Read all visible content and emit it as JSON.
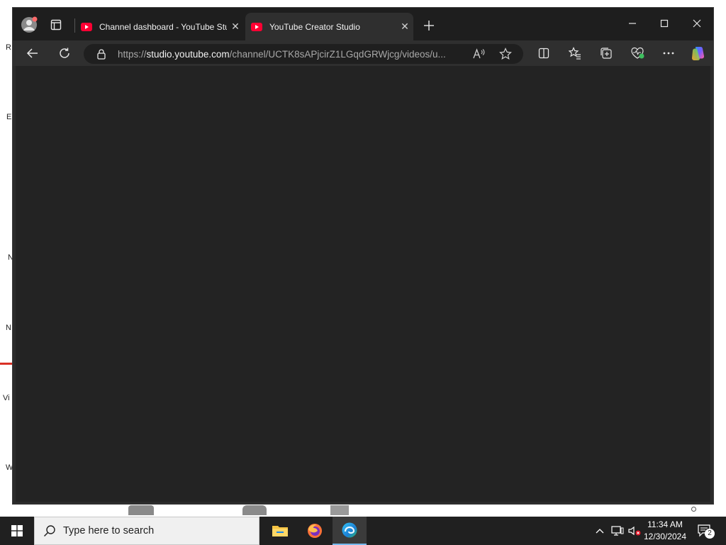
{
  "browser": {
    "tabs": [
      {
        "title": "Channel dashboard - YouTube Studio",
        "active": false
      },
      {
        "title": "YouTube Creator Studio",
        "active": true
      }
    ],
    "new_tab_icon": "plus-icon",
    "address": {
      "scheme": "https://",
      "host": "studio.youtube.com",
      "path": "/channel/UCTK8sAPjcirZ1LGqdGRWjcg/videos/u..."
    },
    "window_controls": [
      "minimize-icon",
      "maximize-icon",
      "close-icon"
    ],
    "toolbar_icons": [
      "read-aloud-icon",
      "favorite-star-icon",
      "split-screen-icon",
      "favorites-icon",
      "collections-icon",
      "browser-essentials-icon",
      "more-icon",
      "copilot-icon"
    ]
  },
  "desktop": {
    "edge_marks": [
      "R",
      "E",
      "N",
      "N",
      "Vi",
      "W"
    ]
  },
  "taskbar": {
    "search_placeholder": "Type here to search",
    "apps": [
      "file-explorer-icon",
      "firefox-icon",
      "edge-icon"
    ],
    "time": "11:34 AM",
    "date": "12/30/2024",
    "notification_count": "2"
  },
  "colors": {
    "titlebar": "#1e1e1e",
    "toolbar": "#2f2f2f",
    "page_background": "#232323",
    "youtube_red": "#ff0033",
    "taskbar": "#202020"
  }
}
